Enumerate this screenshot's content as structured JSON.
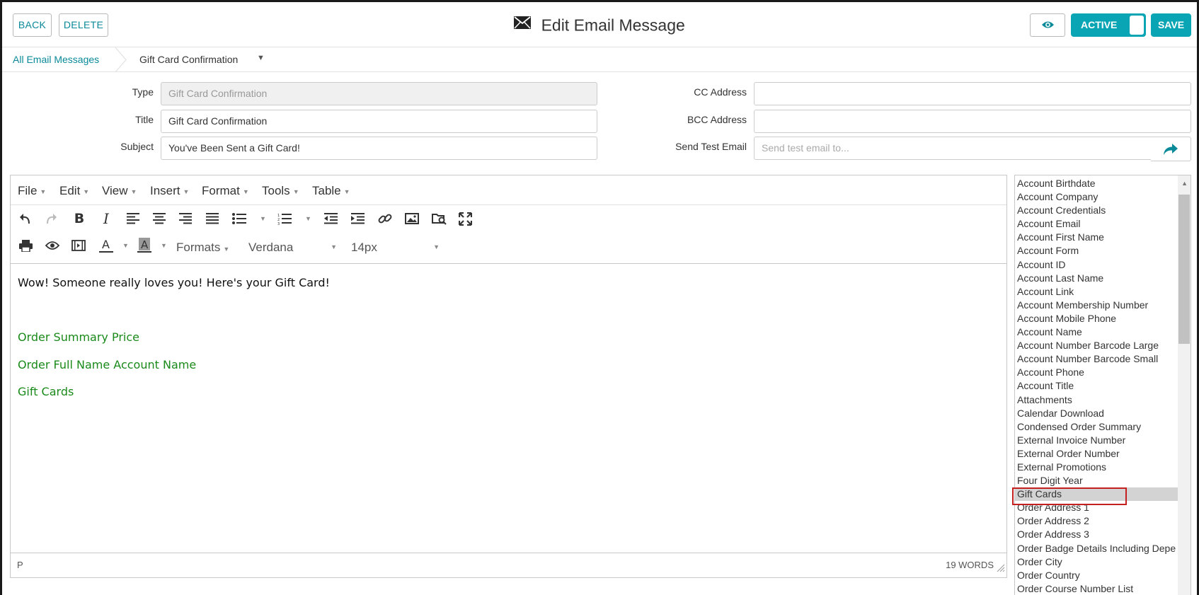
{
  "header": {
    "back_label": "BACK",
    "delete_label": "DELETE",
    "title": "Edit Email Message",
    "active_label": "ACTIVE",
    "save_label": "SAVE"
  },
  "breadcrumb": {
    "parent": "All Email Messages",
    "current": "Gift Card Confirmation"
  },
  "form": {
    "type_label": "Type",
    "type_value": "Gift Card Confirmation",
    "title_label": "Title",
    "title_value": "Gift Card Confirmation",
    "subject_label": "Subject",
    "subject_value": "You've Been Sent a Gift Card!",
    "cc_label": "CC Address",
    "cc_value": "",
    "bcc_label": "BCC Address",
    "bcc_value": "",
    "test_label": "Send Test Email",
    "test_placeholder": "Send test email to..."
  },
  "editor": {
    "menus": [
      "File",
      "Edit",
      "View",
      "Insert",
      "Format",
      "Tools",
      "Table"
    ],
    "formats_label": "Formats",
    "font_label": "Verdana",
    "size_label": "14px",
    "content": {
      "line1": "Wow! Someone really loves you! Here's your Gift Card!",
      "line2": "Order Summary Price",
      "line3": "Order Full Name Account Name",
      "line4": "Gift Cards"
    },
    "status_path": "P",
    "word_count": "19 WORDS"
  },
  "merge_fields": {
    "items": [
      "Account Birthdate",
      "Account Company",
      "Account Credentials",
      "Account Email",
      "Account First Name",
      "Account Form",
      "Account ID",
      "Account Last Name",
      "Account Link",
      "Account Membership Number",
      "Account Mobile Phone",
      "Account Name",
      "Account Number Barcode Large",
      "Account Number Barcode Small",
      "Account Phone",
      "Account Title",
      "Attachments",
      "Calendar Download",
      "Condensed Order Summary",
      "External Invoice Number",
      "External Order Number",
      "External Promotions",
      "Four Digit Year",
      "Gift Cards",
      "Order Address 1",
      "Order Address 2",
      "Order Address 3",
      "Order Badge Details Including Depe",
      "Order City",
      "Order Country",
      "Order Course Number List"
    ],
    "selected": "Gift Cards"
  },
  "colors": {
    "accent": "#0aa5b5",
    "link": "#0a8a99",
    "merge_text": "#1a8a1a",
    "highlight": "#c4201f"
  }
}
